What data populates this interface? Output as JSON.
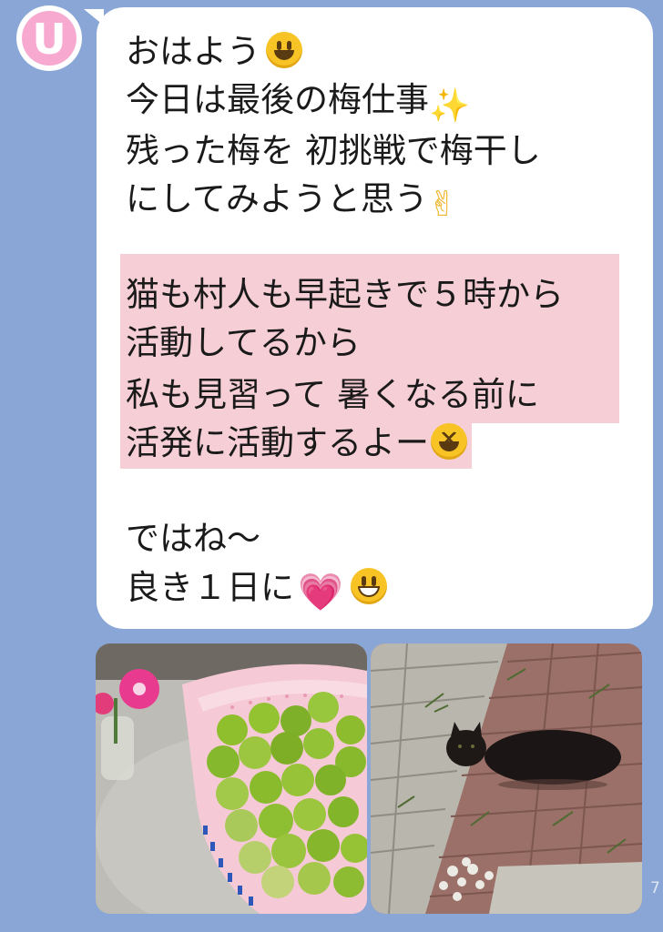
{
  "avatar": {
    "letter": "U",
    "color": "#f7a9d0"
  },
  "message": {
    "lines": [
      "おはよう",
      "今日は最後の梅仕事",
      "残った梅を 初挑戦で梅干し",
      "にしてみようと思う",
      "",
      "猫も村人も早起きで５時から",
      "活動してるから",
      "私も見習って 暑くなる前に",
      "活発に活動するよー",
      "",
      "ではね〜",
      "良き１日に"
    ],
    "highlight_color": "#f6cfd6",
    "bubble_color": "#ffffff"
  },
  "emojis": {
    "smile": "smiling-face-icon",
    "sparkles": "sparkles-icon",
    "victory": "victory-hand-icon",
    "laughing": "laughing-face-icon",
    "heart": "growing-heart-icon",
    "grin": "grinning-face-icon"
  },
  "photos": [
    {
      "name": "plums-photo",
      "subject": "green ume plums in pink colander"
    },
    {
      "name": "cat-photo",
      "subject": "black cat on brick pavement"
    }
  ],
  "timestamp_fragment": "7",
  "background_color": "#8aa6d6"
}
